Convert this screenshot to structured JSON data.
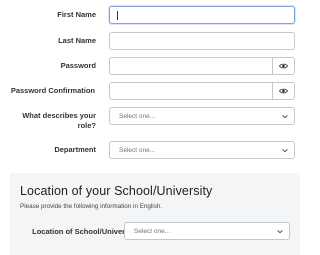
{
  "form": {
    "first_name_label": "First Name",
    "first_name_value": "",
    "last_name_label": "Last Name",
    "last_name_value": "",
    "password_label": "Password",
    "password_confirmation_label": "Password Confirmation",
    "role_label": "What describes your role?",
    "role_selected": "Select one...",
    "department_label": "Department",
    "department_selected": "Select one..."
  },
  "location": {
    "title": "Location of your School/University",
    "subtitle": "Please provide the following information in English.",
    "field_label": "Location of School/University",
    "field_selected": "Select one..."
  },
  "icons": {
    "password_toggle": "eye-icon",
    "password_confirmation_toggle": "eye-icon",
    "select_arrow": "chevron-down-icon"
  },
  "colors": {
    "focus_border": "#7fa6d6",
    "section_background": "#f4f5f7"
  }
}
